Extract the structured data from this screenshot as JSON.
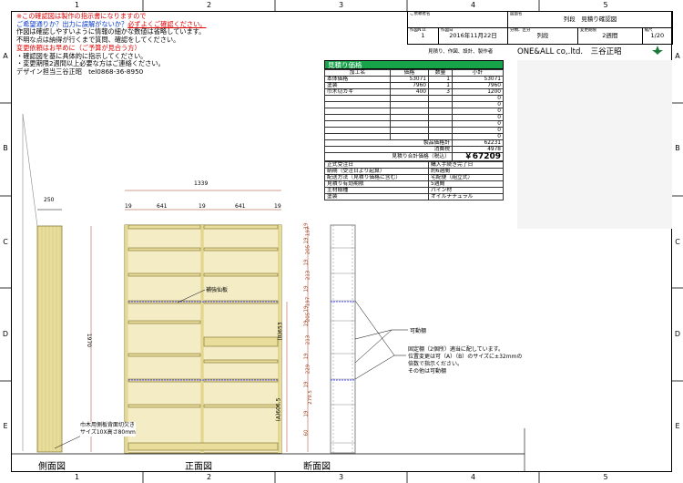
{
  "ruler": {
    "cols": [
      "1",
      "2",
      "3",
      "4",
      "5"
    ],
    "rows": [
      "A",
      "B",
      "C",
      "D",
      "E"
    ]
  },
  "note": {
    "l1": "※この確認図は製作の指示書になりますので",
    "l2a": "ご希望通りか？出力に誤解がないか？",
    "l2b": "必ずよくご確認ください。",
    "l3": "作図は確認しやすいように情報の細かな数値は省略しています。",
    "l4": "不明な点は納得が行くまで質問、確認をしてください。",
    "l5": "変更依頼はお早めに（ご予算が見合う方）",
    "l6": "・確認図を基に具体的に指示してください。",
    "l7": "・変更期限2週間以上必要な方はご連絡ください。",
    "l8": "デザイン担当三谷正昭　tel0868-36-8950"
  },
  "title_block": {
    "customer_label": "ご依頼者名",
    "drawing_label": "図面名",
    "drawing_name": "列段　見積り確認図",
    "no_label": "作図N.O.",
    "no": "1",
    "date_label": "作図日",
    "date": "2016年11月22日",
    "cat_label": "分類、区分",
    "cat": "列段",
    "deadline_label": "変更期限",
    "deadline": "2週間",
    "scale_label": "縮尺",
    "scale": "1/20",
    "roles": "見積り、作図、設計、製作者",
    "company": "ONE&ALL co,.ltd.　三谷正昭"
  },
  "estimate": {
    "title": "見積り価格",
    "headers": [
      "加工名",
      "価格",
      "数量",
      "小計"
    ],
    "rows": [
      [
        "本体価格",
        "53071",
        "1",
        "53071"
      ],
      [
        "塗装",
        "7960",
        "1",
        "7960"
      ],
      [
        "巾木切カキ",
        "400",
        "3",
        "1200"
      ],
      [
        "",
        "",
        "",
        "0"
      ],
      [
        "",
        "",
        "",
        "0"
      ],
      [
        "",
        "",
        "",
        "0"
      ],
      [
        "",
        "",
        "",
        "0"
      ],
      [
        "",
        "",
        "",
        "0"
      ],
      [
        "",
        "",
        "",
        "0"
      ],
      [
        "",
        "",
        "",
        "0"
      ]
    ],
    "product_label": "製品価格計",
    "product_total": "62231",
    "tax_label": "消費税",
    "tax": "4978",
    "grand_label": "見積り合計価格（税込）",
    "grand": "￥67209",
    "info": [
      [
        "正式受注日",
        "購入手続き完了日"
      ],
      [
        "納期（受注日より起算）",
        "約6週間"
      ],
      [
        "配送方法（見積り価格に含む）",
        "宅配便（組立式）"
      ],
      [
        "見積り有効期限",
        "5週間"
      ],
      [
        "主材樹種",
        "パイン材"
      ],
      [
        "塗装",
        "オイルナチュラル"
      ]
    ]
  },
  "dims": {
    "side_depth": "250",
    "width": "1339",
    "height": "1970",
    "d19": "19",
    "d641": "641",
    "sec": [
      "19",
      "197",
      "19",
      "205",
      "19",
      "213",
      "19",
      "197",
      "19",
      "205",
      "19",
      "213",
      "19",
      "229",
      "19",
      "279.5",
      "19",
      "60"
    ],
    "a": "(A)606.5",
    "b": "(B)653"
  },
  "labels": {
    "hokyo": "補強仙板",
    "kadou": "可動棚",
    "fixed1": "固定棚（2個所）適当に配しています。",
    "fixed2": "位置変更は可（A）（B）のサイズに±32mmの",
    "fixed3": "倍数で指示ください。",
    "fixed4": "その他は可動棚",
    "habaki1": "巾木用側板背面切欠き",
    "habaki2": "サイズ10X高さ80mm",
    "side_view": "側面図",
    "front_view": "正面図",
    "section_view": "断面図"
  }
}
